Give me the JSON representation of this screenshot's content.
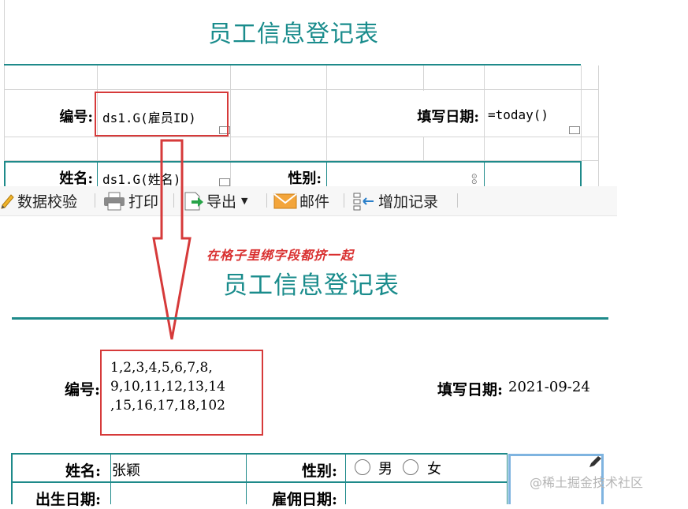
{
  "designer": {
    "title": "员工信息登记表",
    "label_id": "编号:",
    "field_id": "ds1.G(雇员ID)",
    "label_date": "填写日期:",
    "field_date": "=today()",
    "label_name": "姓名:",
    "field_name": "ds1.G(姓名)",
    "label_gender": "性别:"
  },
  "toolbar": {
    "items": [
      {
        "label": "数据校验",
        "icon": "pencil-check-icon"
      },
      {
        "label": "打印",
        "icon": "printer-icon"
      },
      {
        "label": "导出",
        "icon": "export-icon"
      },
      {
        "label": "邮件",
        "icon": "mail-icon"
      },
      {
        "label": "增加记录",
        "icon": "add-record-icon"
      }
    ]
  },
  "annotation": "在格子里绑字段都挤一起",
  "preview": {
    "title": "员工信息登记表",
    "label_id": "编号:",
    "id_values": "1,2,3,4,5,6,7,8,\n9,10,11,12,13,14\n,15,16,17,18,102",
    "label_date": "填写日期:",
    "date_value": "2021-09-24",
    "label_name": "姓名:",
    "name_value": "张颖",
    "label_gender": "性别:",
    "gender_options": [
      "男",
      "女"
    ],
    "label_birth": "出生日期:",
    "label_hire": "雇佣日期:"
  },
  "watermark": "@稀土掘金技术社区",
  "colors": {
    "teal": "#1e8a8a",
    "red": "#d63a3a",
    "title": "#1a8c8c"
  }
}
